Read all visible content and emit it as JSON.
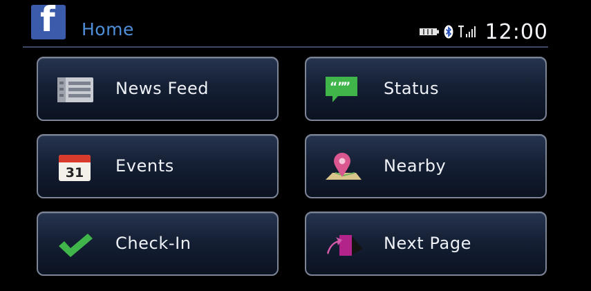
{
  "header": {
    "app_icon": "facebook-logo",
    "title": "Home",
    "status_icons": [
      "battery-icon",
      "bluetooth-icon",
      "signal-icon"
    ],
    "clock": "12:00"
  },
  "menu": {
    "items": [
      {
        "label": "News Feed",
        "icon": "news-feed-icon"
      },
      {
        "label": "Status",
        "icon": "status-icon"
      },
      {
        "label": "Events",
        "icon": "calendar-icon"
      },
      {
        "label": "Nearby",
        "icon": "map-pin-icon"
      },
      {
        "label": "Check-In",
        "icon": "checkmark-icon"
      },
      {
        "label": "Next Page",
        "icon": "next-page-icon"
      }
    ],
    "calendar_day": "31"
  },
  "colors": {
    "title": "#4f8fd9",
    "facebook_brand": "#3b5bab",
    "button_border": "#7d8697",
    "button_bg": "#152035"
  }
}
